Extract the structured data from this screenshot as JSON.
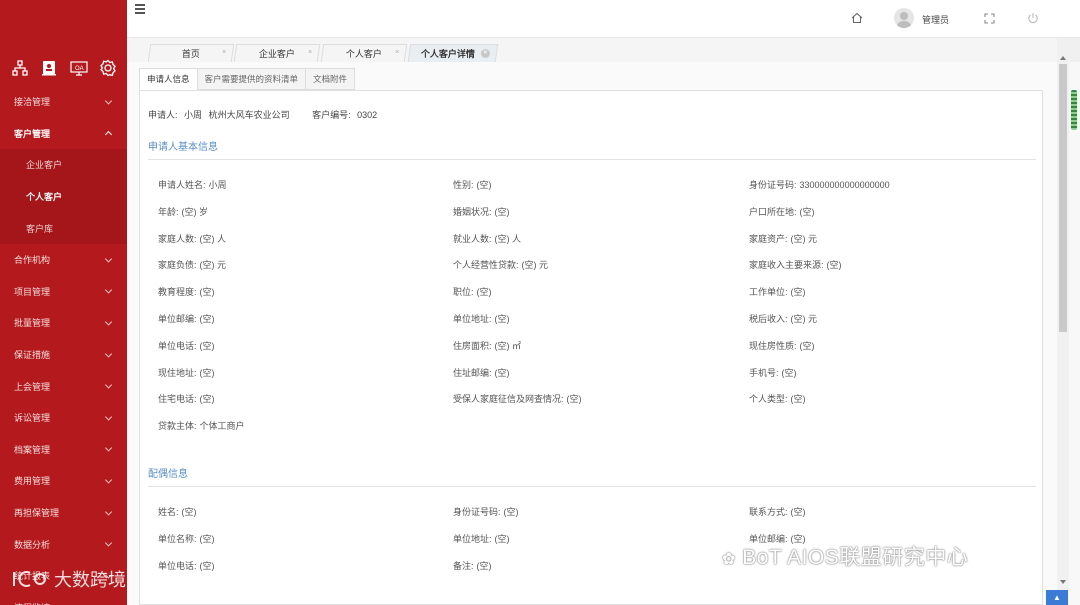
{
  "sidebar": {
    "menu": [
      {
        "label": "接洽管理",
        "state": "closed"
      },
      {
        "label": "客户管理",
        "state": "open",
        "sub": [
          {
            "label": "企业客户",
            "active": false
          },
          {
            "label": "个人客户",
            "active": true
          },
          {
            "label": "客户库",
            "active": false
          }
        ]
      },
      {
        "label": "合作机构",
        "state": "closed"
      },
      {
        "label": "项目管理",
        "state": "closed"
      },
      {
        "label": "批量管理",
        "state": "closed"
      },
      {
        "label": "保证措施",
        "state": "closed"
      },
      {
        "label": "上会管理",
        "state": "closed"
      },
      {
        "label": "诉讼管理",
        "state": "closed"
      },
      {
        "label": "档案管理",
        "state": "closed"
      },
      {
        "label": "费用管理",
        "state": "closed"
      },
      {
        "label": "再担保管理",
        "state": "closed"
      },
      {
        "label": "数据分析",
        "state": "closed"
      },
      {
        "label": "统计报表",
        "state": "closed"
      },
      {
        "label": "流程监控",
        "state": "closed"
      }
    ],
    "watermark": "大数跨境"
  },
  "header": {
    "user_name": "管理员"
  },
  "tabs": [
    {
      "label": "首页",
      "active": false
    },
    {
      "label": "企业客户",
      "active": false
    },
    {
      "label": "个人客户",
      "active": false
    },
    {
      "label": "个人客户详情",
      "active": true
    }
  ],
  "subtabs": [
    {
      "label": "申请人信息",
      "active": true
    },
    {
      "label": "客户需要提供的资料清单",
      "active": false
    },
    {
      "label": "文档附件",
      "active": false
    }
  ],
  "top_line": {
    "applicant_label": "申请人:",
    "applicant_name": "小周",
    "company": "杭州大风车农业公司",
    "customer_no_label": "客户编号:",
    "customer_no": "0302"
  },
  "section_basic": {
    "title": "申请人基本信息",
    "fields": [
      {
        "label": "申请人姓名:",
        "value": "小周"
      },
      {
        "label": "性别:",
        "value": "(空)"
      },
      {
        "label": "身份证号码:",
        "value": "330000000000000000"
      },
      {
        "label": "年龄:",
        "value": "(空)  岁"
      },
      {
        "label": "婚姻状况:",
        "value": "(空)"
      },
      {
        "label": "户口所在地:",
        "value": "(空)"
      },
      {
        "label": "家庭人数:",
        "value": "(空)  人"
      },
      {
        "label": "就业人数:",
        "value": "(空)  人"
      },
      {
        "label": "家庭资产:",
        "value": "(空)  元"
      },
      {
        "label": "家庭负债:",
        "value": "(空)  元"
      },
      {
        "label": "个人经营性贷款:",
        "value": "(空)  元"
      },
      {
        "label": "家庭收入主要来源:",
        "value": "(空)"
      },
      {
        "label": "教育程度:",
        "value": "(空)"
      },
      {
        "label": "职位:",
        "value": "(空)"
      },
      {
        "label": "工作单位:",
        "value": "(空)"
      },
      {
        "label": "单位邮编:",
        "value": "(空)"
      },
      {
        "label": "单位地址:",
        "value": "(空)"
      },
      {
        "label": "税后收入:",
        "value": "(空)  元"
      },
      {
        "label": "单位电话:",
        "value": "(空)"
      },
      {
        "label": "住房面积:",
        "value": "(空)  ㎡"
      },
      {
        "label": "现住房性质:",
        "value": "(空)"
      },
      {
        "label": "现住地址:",
        "value": "(空)"
      },
      {
        "label": "住址邮编:",
        "value": "(空)"
      },
      {
        "label": "手机号:",
        "value": "(空)"
      },
      {
        "label": "住宅电话:",
        "value": "(空)"
      },
      {
        "label": "受保人家庭征信及网查情况:",
        "value": "(空)"
      },
      {
        "label": "个人类型:",
        "value": "(空)"
      },
      {
        "label": "贷款主体:",
        "value": "个体工商户"
      }
    ]
  },
  "section_spouse": {
    "title": "配偶信息",
    "fields": [
      {
        "label": "姓名:",
        "value": "(空)"
      },
      {
        "label": "身份证号码:",
        "value": "(空)"
      },
      {
        "label": "联系方式:",
        "value": "(空)"
      },
      {
        "label": "单位名称:",
        "value": "(空)"
      },
      {
        "label": "单位地址:",
        "value": "(空)"
      },
      {
        "label": "单位邮编:",
        "value": "(空)"
      },
      {
        "label": "单位电话:",
        "value": "(空)"
      },
      {
        "label": "备注:",
        "value": "(空)"
      }
    ]
  },
  "watermark_right": "BoT AIOS联盟研究中心",
  "back_top_label": "▲"
}
